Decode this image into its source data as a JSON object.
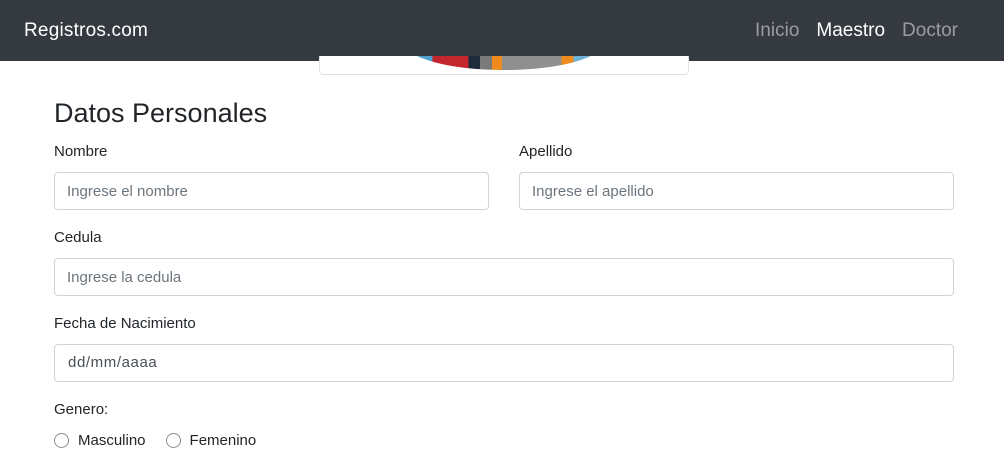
{
  "navbar": {
    "brand": "Registros.com",
    "links": [
      {
        "label": "Inicio",
        "active": false
      },
      {
        "label": "Maestro",
        "active": true
      },
      {
        "label": "Doctor",
        "active": false
      }
    ]
  },
  "form": {
    "title": "Datos Personales",
    "nombre": {
      "label": "Nombre",
      "placeholder": "Ingrese el nombre"
    },
    "apellido": {
      "label": "Apellido",
      "placeholder": "Ingrese el apellido"
    },
    "cedula": {
      "label": "Cedula",
      "placeholder": "Ingrese la cedula"
    },
    "fecha": {
      "label": "Fecha de Nacimiento",
      "value": "dd/mm/aaaa"
    },
    "genero": {
      "label": "Genero:",
      "options": [
        "Masculino",
        "Femenino"
      ]
    }
  }
}
